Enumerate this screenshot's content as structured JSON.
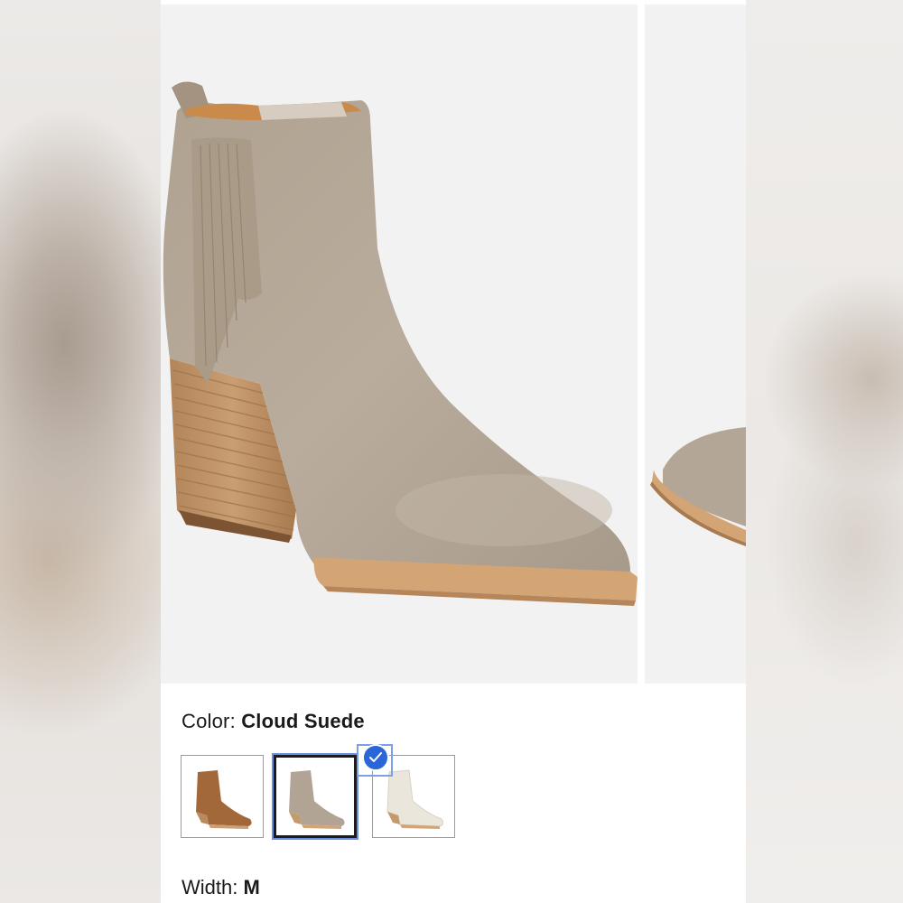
{
  "product": {
    "color_label": "Color:",
    "color_value": "Cloud Suede",
    "width_label": "Width:",
    "width_value": "M",
    "swatches": [
      {
        "name": "cognac",
        "color": "#a0673a",
        "selected": false
      },
      {
        "name": "cloud-suede",
        "color": "#b3a595",
        "selected": true
      },
      {
        "name": "white",
        "color": "#ece8e0",
        "selected": false
      }
    ]
  },
  "colors": {
    "suede": "#b7a998",
    "heel_wood": "#c49a6c",
    "sole": "#d2a477",
    "selected_badge": "#2a66d9",
    "image_background": "#f2f2f2"
  },
  "icons": [
    "checkmark-icon"
  ]
}
